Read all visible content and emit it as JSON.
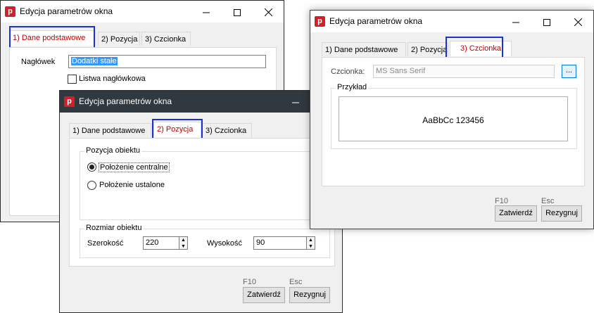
{
  "windows": {
    "w1": {
      "title": "Edycja parametrów okna",
      "tabs": [
        "1) Dane podstawowe",
        "2) Pozycja",
        "3) Czcionka"
      ],
      "naglowek_label": "Nagłówek",
      "naglowek_value": "Dodatki stałe",
      "listwa_label": "Listwa nagłówkowa"
    },
    "w2": {
      "title": "Edycja parametrów okna",
      "tabs": [
        "1) Dane podstawowe",
        "2) Pozycja",
        "3) Czcionka"
      ],
      "pozycja_group": "Pozycja obiektu",
      "radio_central": "Położenie centralne",
      "radio_fixed": "Położenie ustalone",
      "rozmiar_group": "Rozmiar obiektu",
      "szerokosc_label": "Szerokość",
      "szerokosc_value": "220",
      "wysokosc_label": "Wysokość",
      "wysokosc_value": "90",
      "f10": "F10",
      "esc": "Esc",
      "zatwierdz": "Zatwierdź",
      "rezygnuj": "Rezygnuj"
    },
    "w3": {
      "title": "Edycja parametrów okna",
      "tabs": [
        "1) Dane podstawowe",
        "2) Pozycja",
        "3) Czcionka"
      ],
      "czcionka_label": "Czcionka:",
      "czcionka_value": "MS Sans Serif",
      "ellipsis": "...",
      "przyklad": "Przykład",
      "sample_text": "AaBbCc 123456",
      "f10": "F10",
      "esc": "Esc",
      "zatwierdz": "Zatwierdź",
      "rezygnuj": "Rezygnuj"
    }
  },
  "app_icon_letter": "p",
  "colors": {
    "accent_highlight": "#1a2fd6",
    "selected_tab_text": "#c00000",
    "app_icon": "#d32027",
    "dark_titlebar": "#303840"
  }
}
